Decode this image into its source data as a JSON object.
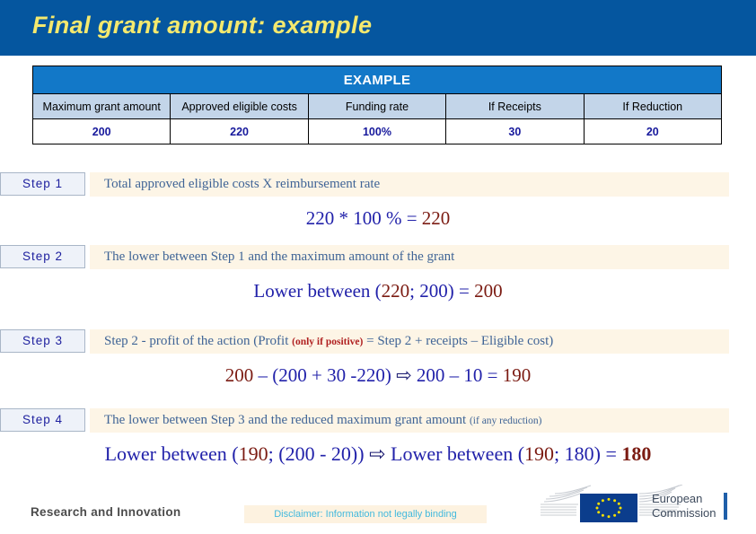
{
  "title": "Final grant amount: example",
  "table": {
    "banner": "EXAMPLE",
    "headers": [
      "Maximum grant amount",
      "Approved eligible costs",
      "Funding rate",
      "If Receipts",
      "If Reduction"
    ],
    "values": [
      "200",
      "220",
      "100%",
      "30",
      "20"
    ]
  },
  "steps": [
    {
      "badge": "Step 1",
      "desc": "Total approved eligible costs  X  reimbursement rate",
      "formula_parts": [
        {
          "text": "220 * 100 % = ",
          "color": "blue"
        },
        {
          "text": "220",
          "color": "red"
        }
      ]
    },
    {
      "badge": "Step 2",
      "desc": "The lower between Step 1 and the maximum amount of the grant",
      "formula_parts": [
        {
          "text": "Lower between (",
          "color": "blue"
        },
        {
          "text": "220",
          "color": "red"
        },
        {
          "text": "; 200) = ",
          "color": "blue"
        },
        {
          "text": "200",
          "color": "red"
        }
      ]
    },
    {
      "badge": "Step 3",
      "desc_before": "Step 2 - profit of the action  (Profit ",
      "desc_note": "(only if positive)",
      "desc_after": " = Step 2 + receipts – Eligible cost)",
      "formula_parts": [
        {
          "text": "200",
          "color": "red"
        },
        {
          "text": " – (200 + 30 -220)  ",
          "color": "blue"
        },
        {
          "text": "⇨",
          "color": "navy"
        },
        {
          "text": " 200 – 10 = ",
          "color": "blue"
        },
        {
          "text": "190",
          "color": "red"
        }
      ]
    },
    {
      "badge": "Step 4",
      "desc_before": "The lower between Step 3 and the reduced maximum grant amount  ",
      "desc_note_plain": "(if any reduction)",
      "formula_parts": [
        {
          "text": "Lower between (",
          "color": "blue"
        },
        {
          "text": "190",
          "color": "red"
        },
        {
          "text": "; (200 - 20))  ",
          "color": "blue"
        },
        {
          "text": "⇨",
          "color": "navy"
        },
        {
          "text": " Lower between (",
          "color": "blue"
        },
        {
          "text": "190",
          "color": "red"
        },
        {
          "text": "; 180) = ",
          "color": "blue"
        },
        {
          "text": "180",
          "color": "bold-red"
        }
      ]
    }
  ],
  "footer": {
    "research": "Research and Innovation",
    "disclaimer": "Disclaimer: Information not legally binding",
    "commission_line1": "European",
    "commission_line2": "Commission"
  },
  "colors": {
    "header_blue": "#05569f",
    "title_yellow": "#f5e96e",
    "table_banner_blue": "#1278c8",
    "table_head_blue": "#c3d5e9",
    "value_blue": "#17199c",
    "band_cream": "#fdf5e6",
    "desc_blue": "#3f6496",
    "formula_blue": "#2222aa",
    "formula_red": "#7b1b12",
    "note_red": "#b02121",
    "disclaimer_cyan": "#43b9dd"
  }
}
